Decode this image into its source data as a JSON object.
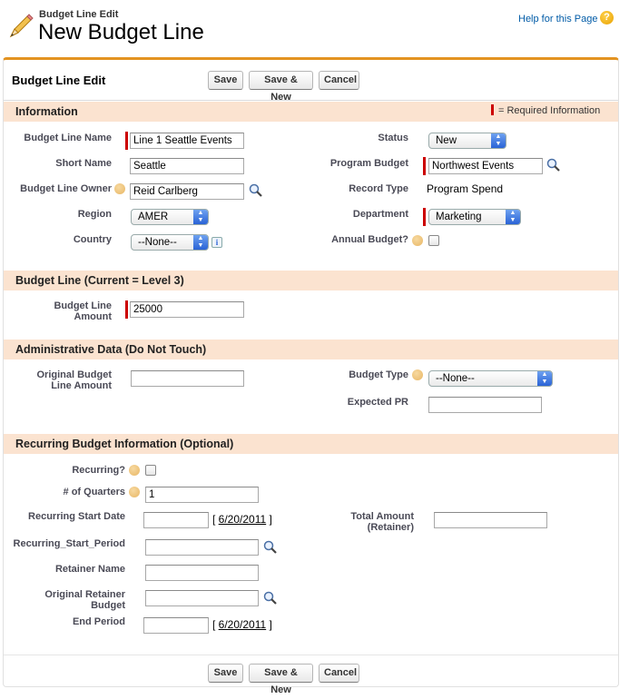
{
  "header": {
    "breadcrumb": "Budget Line Edit",
    "title": "New Budget Line",
    "help_link": "Help for this Page",
    "help_icon": "question-icon"
  },
  "panel": {
    "title": "Budget Line Edit",
    "buttons": {
      "save": "Save",
      "save_new": "Save & New",
      "cancel": "Cancel"
    },
    "required_legend": "= Required Information"
  },
  "sections": {
    "information": "Information",
    "budget_line": "Budget Line (Current = Level 3)",
    "admin": "Administrative Data (Do Not Touch)",
    "recurring": "Recurring Budget Information (Optional)"
  },
  "information": {
    "budget_line_name": {
      "label": "Budget Line Name",
      "value": "Line 1 Seattle Events"
    },
    "short_name": {
      "label": "Short Name",
      "value": "Seattle"
    },
    "owner": {
      "label": "Budget Line Owner",
      "value": "Reid Carlberg"
    },
    "region": {
      "label": "Region",
      "value": "AMER"
    },
    "country": {
      "label": "Country",
      "value": "--None--"
    },
    "status": {
      "label": "Status",
      "value": "New"
    },
    "program_budget": {
      "label": "Program Budget",
      "value": "Northwest Events"
    },
    "record_type": {
      "label": "Record Type",
      "value": "Program Spend"
    },
    "department": {
      "label": "Department",
      "value": "Marketing"
    },
    "annual_budget": {
      "label": "Annual Budget?",
      "checked": false
    }
  },
  "budget_line": {
    "amount": {
      "label_1": "Budget Line",
      "label_2": "Amount",
      "value": "25000"
    }
  },
  "admin": {
    "original_amount": {
      "label_1": "Original Budget",
      "label_2": "Line Amount",
      "value": ""
    },
    "budget_type": {
      "label": "Budget Type",
      "value": "--None--"
    },
    "expected_pr": {
      "label": "Expected PR",
      "value": ""
    }
  },
  "recurring": {
    "recurring": {
      "label": "Recurring?",
      "checked": false
    },
    "quarters": {
      "label": "# of Quarters",
      "value": "1"
    },
    "start_date": {
      "label": "Recurring Start Date",
      "value": "",
      "today_link": "6/20/2011"
    },
    "start_period": {
      "label": "Recurring_Start_Period",
      "value": ""
    },
    "retainer_name": {
      "label": "Retainer Name",
      "value": ""
    },
    "original_retainer": {
      "label_1": "Original Retainer",
      "label_2": "Budget",
      "value": ""
    },
    "end_period": {
      "label": "End Period",
      "value": "",
      "today_link": "6/20/2011"
    },
    "total_amount": {
      "label_1": "Total Amount",
      "label_2": "(Retainer)",
      "value": ""
    }
  },
  "colors": {
    "accent": "#e39321",
    "section_bg": "#fbe3d0",
    "required": "#cc0000",
    "link": "#015ba7"
  }
}
